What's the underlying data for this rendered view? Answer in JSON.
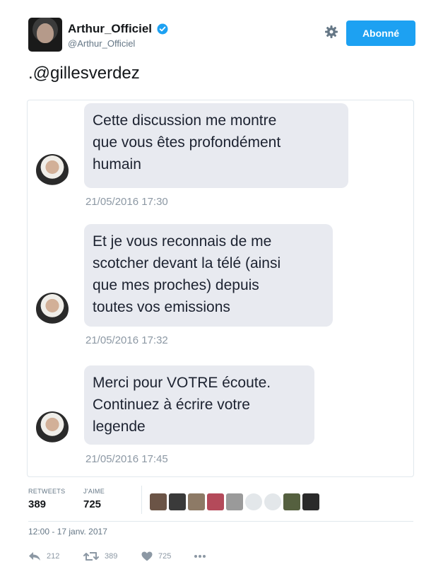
{
  "header": {
    "display_name": "Arthur_Officiel",
    "handle": "@Arthur_Officiel",
    "follow_label": "Abonné"
  },
  "tweet": {
    "text": ".@gillesverdez"
  },
  "conversation": {
    "messages": [
      {
        "text": "Cette discussion me montre\nque vous êtes profondément\nhumain",
        "time": "21/05/2016 17:30"
      },
      {
        "text": "Et je vous reconnais de me\nscotcher devant la télé (ainsi\nque mes proches) depuis\ntoutes vos emissions",
        "time": "21/05/2016 17:32"
      },
      {
        "text": "Merci pour VOTRE écoute.\nContinuez à écrire votre\nlegende",
        "time": "21/05/2016 17:45"
      }
    ]
  },
  "stats": {
    "retweets_label": "RETWEETS",
    "retweets_value": "389",
    "likes_label": "J'AIME",
    "likes_value": "725"
  },
  "timestamp": "12:00 - 17 janv. 2017",
  "actions": {
    "reply_count": "212",
    "retweet_count": "389",
    "like_count": "725"
  },
  "colors": {
    "accent": "#1da1f2",
    "bubble": "#e8eaf0",
    "muted": "#8c98a4"
  },
  "icons": [
    "verified-badge-icon",
    "gear-icon",
    "reply-icon",
    "retweet-icon",
    "heart-icon",
    "more-icon"
  ]
}
